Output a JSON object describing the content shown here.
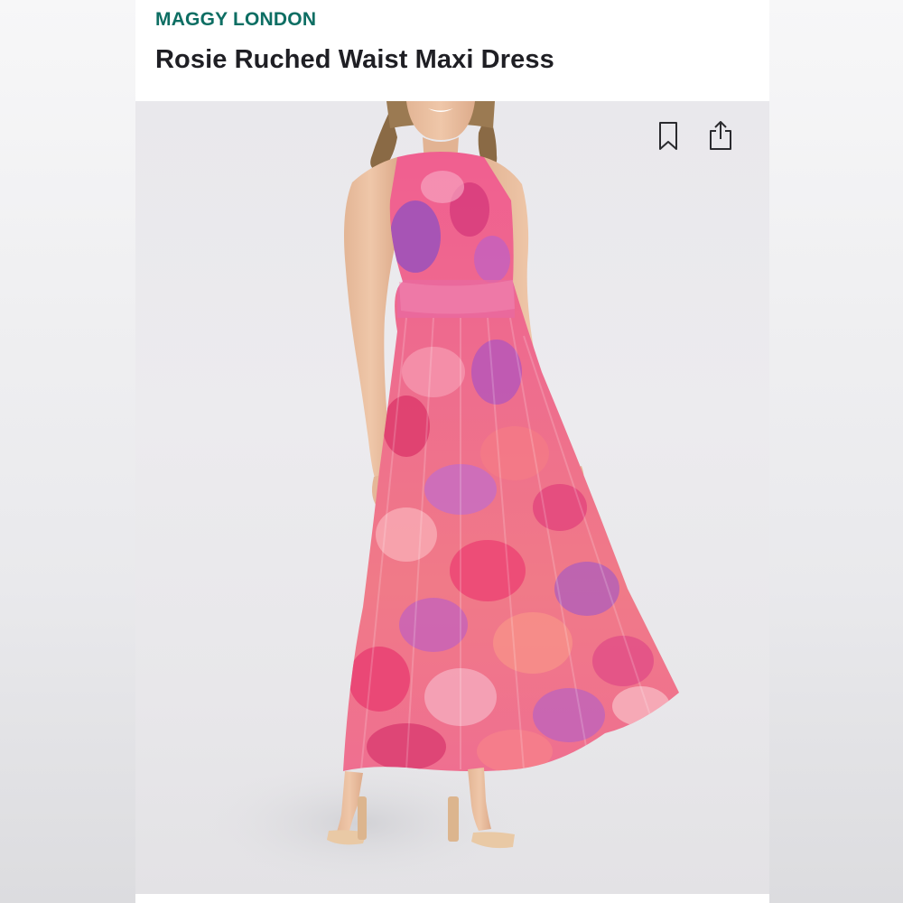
{
  "product": {
    "brand": "MAGGY LONDON",
    "title": "Rosie Ruched Waist Maxi Dress"
  },
  "actions": {
    "bookmark_icon": "bookmark-icon",
    "share_icon": "share-icon"
  },
  "colors": {
    "brand": "#0d6e63",
    "title": "#1f1f24",
    "dress_pink": "#ec4f7f",
    "dress_purple": "#9a5ac8",
    "dress_coral": "#f6857a"
  }
}
